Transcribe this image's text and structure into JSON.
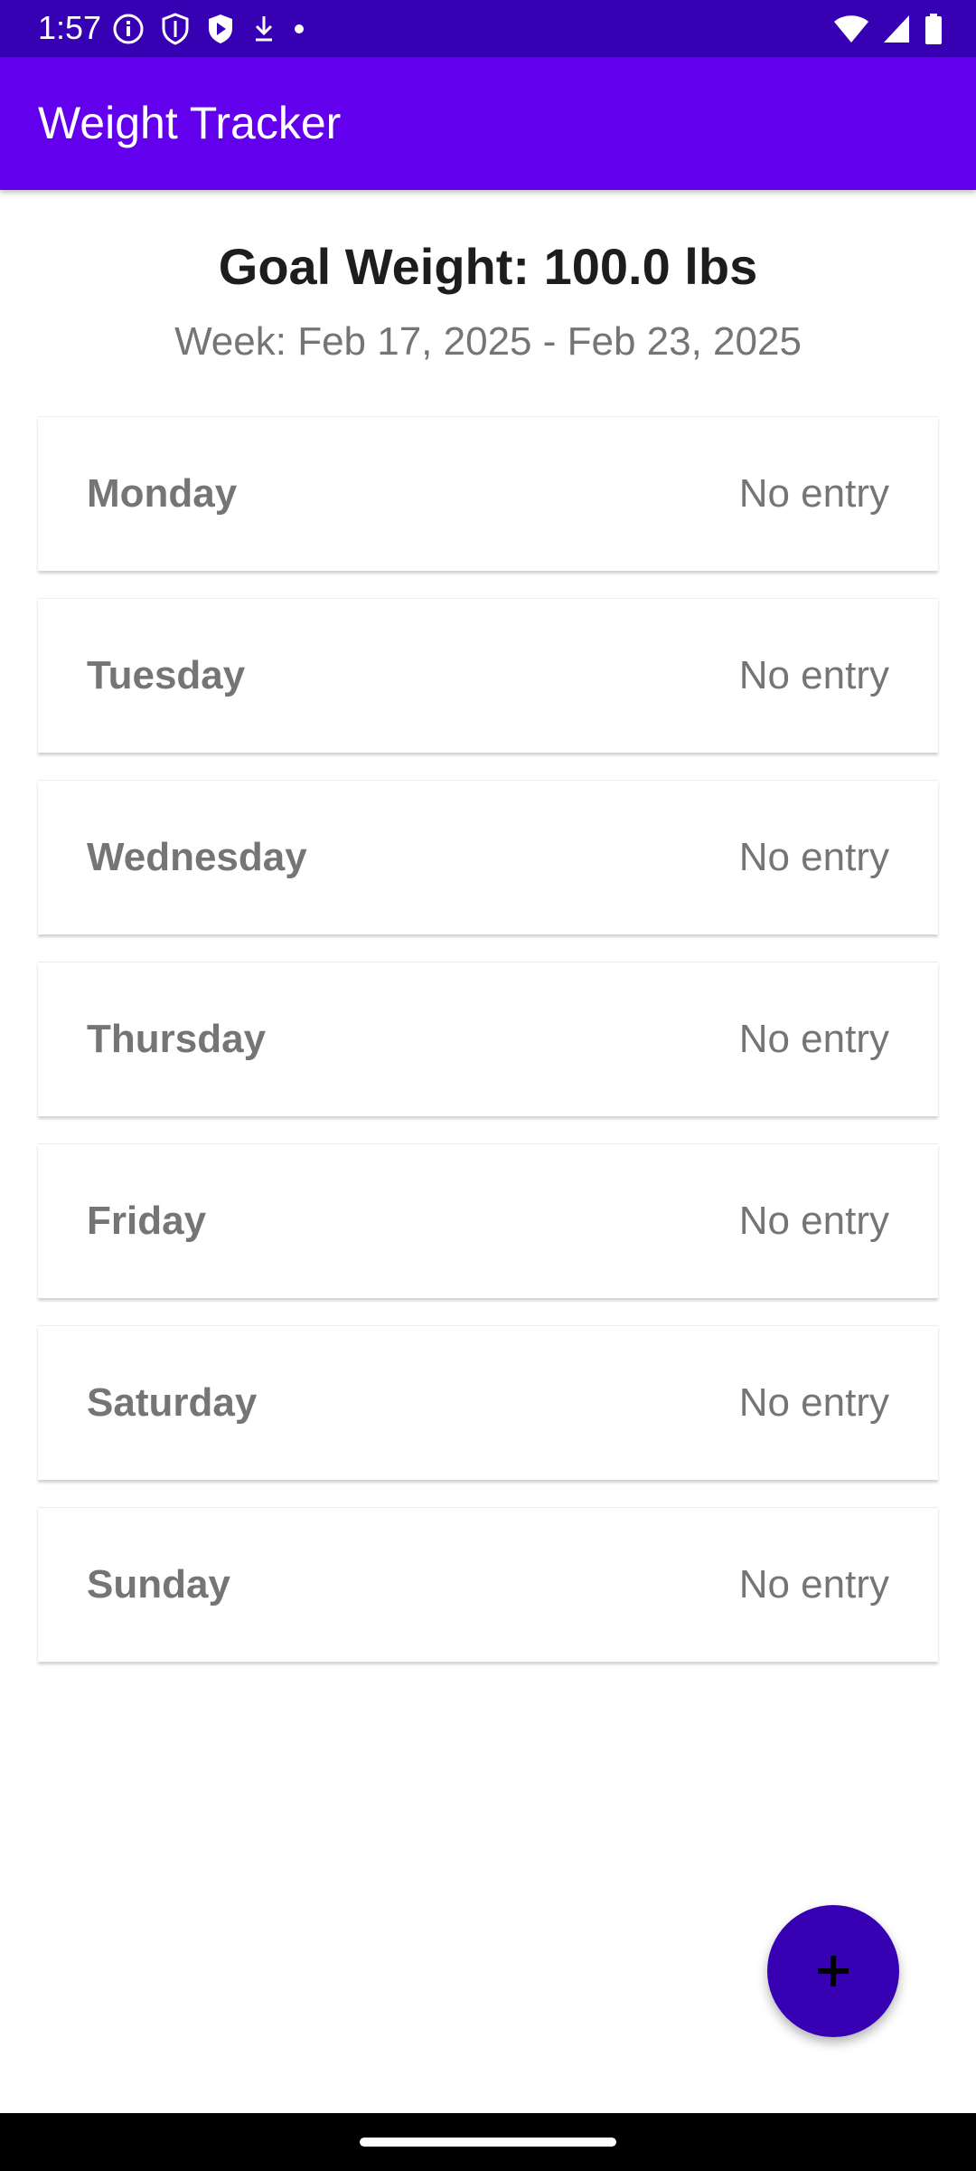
{
  "status_bar": {
    "time": "1:57",
    "left_icons": [
      "info-icon",
      "shield-icon",
      "shield-play-icon",
      "download-icon",
      "dot-icon"
    ],
    "right_icons": [
      "wifi-icon",
      "signal-icon",
      "battery-icon"
    ]
  },
  "app_bar": {
    "title": "Weight Tracker"
  },
  "header": {
    "goal": "Goal Weight: 100.0 lbs",
    "week": "Week: Feb 17, 2025 - Feb 23, 2025"
  },
  "days": [
    {
      "name": "Monday",
      "value": "No entry"
    },
    {
      "name": "Tuesday",
      "value": "No entry"
    },
    {
      "name": "Wednesday",
      "value": "No entry"
    },
    {
      "name": "Thursday",
      "value": "No entry"
    },
    {
      "name": "Friday",
      "value": "No entry"
    },
    {
      "name": "Saturday",
      "value": "No entry"
    },
    {
      "name": "Sunday",
      "value": "No entry"
    }
  ],
  "fab": {
    "icon": "plus-icon"
  },
  "colors": {
    "status_bar": "#3700b3",
    "app_bar": "#6200ee",
    "fab": "#3700b3",
    "muted_text": "#757575"
  }
}
